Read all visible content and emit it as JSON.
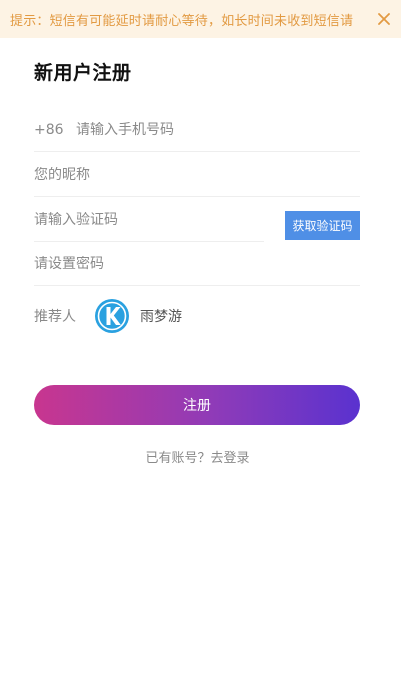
{
  "notice": {
    "text": "提示：短信有可能延时请耐心等待，如长时间未收到短信请",
    "close_icon": "close-icon"
  },
  "title": "新用户注册",
  "phone": {
    "prefix": "+86",
    "placeholder": "请输入手机号码",
    "value": ""
  },
  "nickname": {
    "placeholder": "您的昵称",
    "value": ""
  },
  "code": {
    "placeholder": "请输入验证码",
    "value": "",
    "button_label": "获取验证码"
  },
  "password": {
    "placeholder": "请设置密码",
    "value": ""
  },
  "referrer": {
    "label": "推荐人",
    "avatar_icon": "kugou-k-avatar-icon",
    "name": "雨梦游"
  },
  "register_button": "注册",
  "login_link": "已有账号？去登录",
  "colors": {
    "notice_bg": "#fdf3e4",
    "notice_text": "#e29a42",
    "code_button": "#4f8fe6",
    "gradient_start": "#c8368f",
    "gradient_end": "#5a32cf",
    "avatar": "#2aa1e0"
  }
}
